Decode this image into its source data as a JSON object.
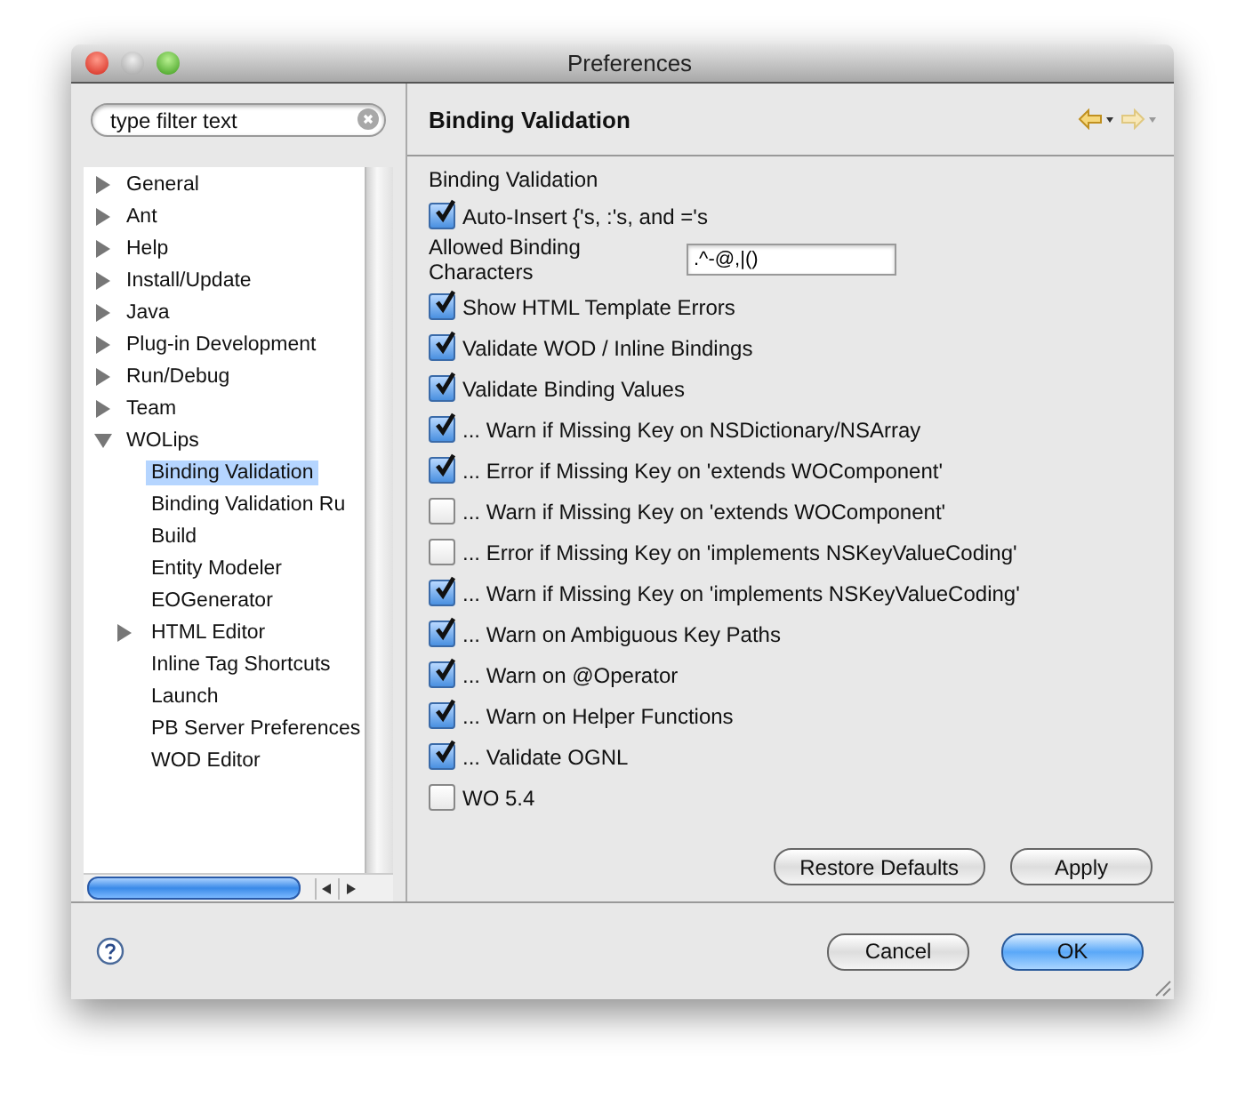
{
  "window": {
    "title": "Preferences"
  },
  "filter": {
    "placeholder": "type filter text"
  },
  "tree": [
    {
      "label": "General",
      "kind": "branch",
      "expanded": false,
      "selected": false
    },
    {
      "label": "Ant",
      "kind": "branch",
      "expanded": false,
      "selected": false
    },
    {
      "label": "Help",
      "kind": "branch",
      "expanded": false,
      "selected": false
    },
    {
      "label": "Install/Update",
      "kind": "branch",
      "expanded": false,
      "selected": false
    },
    {
      "label": "Java",
      "kind": "branch",
      "expanded": false,
      "selected": false
    },
    {
      "label": "Plug-in Development",
      "kind": "branch",
      "expanded": false,
      "selected": false
    },
    {
      "label": "Run/Debug",
      "kind": "branch",
      "expanded": false,
      "selected": false
    },
    {
      "label": "Team",
      "kind": "branch",
      "expanded": false,
      "selected": false
    },
    {
      "label": "WOLips",
      "kind": "branch",
      "expanded": true,
      "selected": false,
      "children": [
        {
          "label": "Binding Validation",
          "kind": "leaf",
          "selected": true
        },
        {
          "label": "Binding Validation Ru",
          "kind": "leaf",
          "selected": false
        },
        {
          "label": "Build",
          "kind": "leaf",
          "selected": false
        },
        {
          "label": "Entity Modeler",
          "kind": "leaf",
          "selected": false
        },
        {
          "label": "EOGenerator",
          "kind": "leaf",
          "selected": false
        },
        {
          "label": "HTML Editor",
          "kind": "branch",
          "expanded": false,
          "selected": false
        },
        {
          "label": "Inline Tag Shortcuts",
          "kind": "leaf",
          "selected": false
        },
        {
          "label": "Launch",
          "kind": "leaf",
          "selected": false
        },
        {
          "label": "PB Server Preferences",
          "kind": "leaf",
          "selected": false
        },
        {
          "label": "WOD Editor",
          "kind": "leaf",
          "selected": false
        }
      ]
    }
  ],
  "page": {
    "title": "Binding Validation",
    "group_label": "Binding Validation",
    "auto_insert": {
      "label": "Auto-Insert {'s, :'s, and ='s",
      "checked": true
    },
    "allowed_chars": {
      "label": "Allowed Binding Characters",
      "value": ".^-@,|()"
    },
    "options": [
      {
        "label": "Show HTML Template Errors",
        "checked": true
      },
      {
        "label": "Validate WOD / Inline Bindings",
        "checked": true
      },
      {
        "label": "Validate Binding Values",
        "checked": true
      },
      {
        "label": "... Warn if Missing Key on NSDictionary/NSArray",
        "checked": true
      },
      {
        "label": "... Error if Missing Key on 'extends WOComponent'",
        "checked": true
      },
      {
        "label": "... Warn if Missing Key on 'extends WOComponent'",
        "checked": false
      },
      {
        "label": "... Error if Missing Key on 'implements NSKeyValueCoding'",
        "checked": false
      },
      {
        "label": "... Warn if Missing Key on 'implements NSKeyValueCoding'",
        "checked": true
      },
      {
        "label": "... Warn on Ambiguous Key Paths",
        "checked": true
      },
      {
        "label": "... Warn on @Operator",
        "checked": true
      },
      {
        "label": "... Warn on Helper Functions",
        "checked": true
      },
      {
        "label": "... Validate OGNL",
        "checked": true
      },
      {
        "label": "WO 5.4",
        "checked": false
      }
    ],
    "buttons": [
      "Restore Defaults",
      "Apply"
    ]
  },
  "footer": {
    "buttons": [
      {
        "label": "Cancel",
        "kind": "normal"
      },
      {
        "label": "OK",
        "kind": "default"
      }
    ]
  }
}
